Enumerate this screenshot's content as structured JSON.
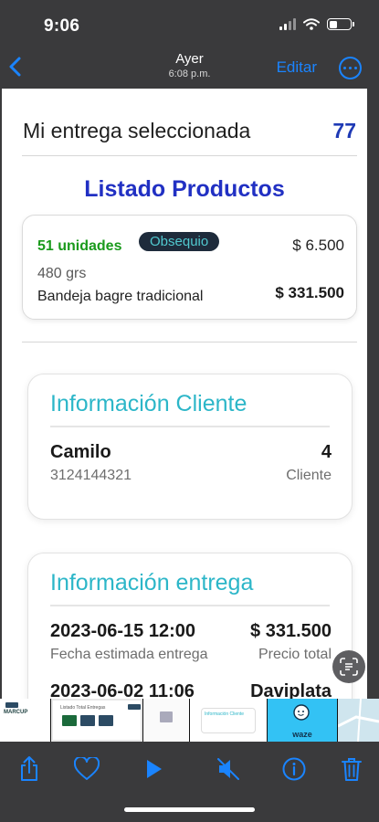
{
  "status": {
    "time": "9:06"
  },
  "nav": {
    "title": "Ayer",
    "subtitle": "6:08 p.m.",
    "edit_label": "Editar"
  },
  "header": {
    "title": "Mi entrega seleccionada",
    "count": "77"
  },
  "products": {
    "title": "Listado Productos",
    "item": {
      "quantity": "51 unidades",
      "badge": "Obsequio",
      "unit_price": "$ 6.500",
      "weight": "480 grs",
      "name": "Bandeja bagre tradicional",
      "total": "$ 331.500"
    }
  },
  "client": {
    "title": "Información Cliente",
    "name": "Camilo",
    "phone": "3124144321",
    "number": "4",
    "number_label": "Cliente"
  },
  "delivery": {
    "title": "Información entrega",
    "estimated_date": "2023-06-15 12:00",
    "estimated_label": "Fecha estimada entrega",
    "price": "$ 331.500",
    "price_label": "Precio total",
    "second_date": "2023-06-02 11:06",
    "payment": "Daviplata"
  },
  "thumbs": {
    "waze_label": "waze",
    "info_label": "Información Cliente",
    "list_label": "Listado Total Entregas"
  },
  "colors": {
    "accent": "#1a84ff",
    "title_blue": "#2130c3",
    "teal": "#2cb6c8",
    "green": "#1a9a1c",
    "count": "#1f3ab5"
  },
  "toolbar": {
    "icons": [
      "share-icon",
      "heart-icon",
      "play-icon",
      "mute-icon",
      "info-icon",
      "trash-icon"
    ]
  }
}
